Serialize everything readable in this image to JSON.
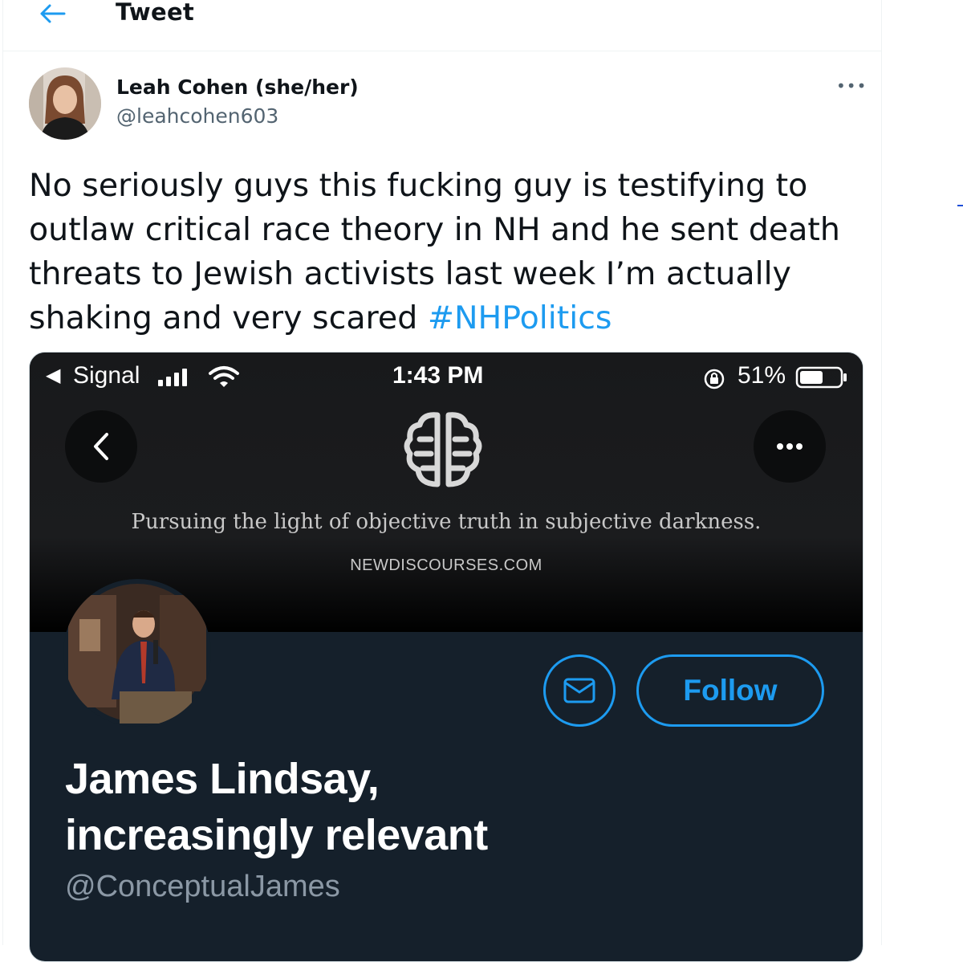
{
  "header": {
    "title": "Tweet"
  },
  "tweet": {
    "author_name": "Leah Cohen (she/her)",
    "author_handle": "@leahcohen603",
    "text": "No seriously guys this fucking guy is testifying to outlaw critical race theory in NH and he sent death threats to Jewish activists last week I’m actually shaking and very scared ",
    "hashtag": "#NHPolitics",
    "more_label": "•••"
  },
  "screenshot": {
    "status_bar": {
      "back": "◀",
      "carrier": "Signal",
      "time": "1:43 PM",
      "battery": "51%"
    },
    "banner": {
      "tagline": "Pursuing the light of objective truth in subjective darkness.",
      "url": "NEWDISCOURSES.COM"
    },
    "profile": {
      "name_line1": "James Lindsay,",
      "name_line2": "increasingly relevant",
      "handle": "@ConceptualJames",
      "follow_label": "Follow"
    }
  },
  "colors": {
    "accent": "#1d9bf0",
    "dark_bg": "#15202b",
    "muted": "#536471"
  },
  "icons": [
    "back-arrow-icon",
    "more-icon",
    "signal-bars-icon",
    "wifi-icon",
    "rotation-lock-icon",
    "battery-icon",
    "chevron-left-icon",
    "brain-logo-icon",
    "mail-icon"
  ]
}
